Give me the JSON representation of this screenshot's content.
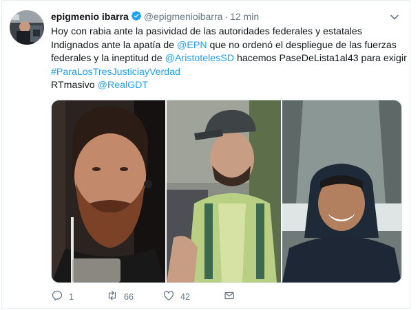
{
  "tweet": {
    "author": {
      "name": "epigmenio ibarra",
      "handle": "@epigmenioibarra",
      "verified": true
    },
    "separator": "·",
    "timestamp": "12 min",
    "text": {
      "line1": "Hoy con rabia ante la pasividad de las autoridades federales y estatales",
      "line2_a": "Indignados ante la apatía de ",
      "line2_link": "@EPN",
      "line2_b": " que no ordenó el despliegue de las fuerzas",
      "line3_a": "federales y la ineptitud de ",
      "line3_link": "@AristotelesSD",
      "line3_b": " hacemos PaseDeLista1al43 para exigir",
      "line4_link": "#ParaLosTresJusticiayVerdad",
      "line5_a": "RTmasivo ",
      "line5_link": "@RealGDT"
    },
    "stats": {
      "replies": "1",
      "retweets": "66",
      "likes": "42"
    },
    "colors": {
      "link": "#1da1f2",
      "muted": "#657786",
      "text": "#14171a"
    },
    "icons": [
      "reply-icon",
      "retweet-icon",
      "like-icon",
      "direct-message-icon",
      "verified-badge-icon",
      "chevron-down-icon"
    ]
  }
}
